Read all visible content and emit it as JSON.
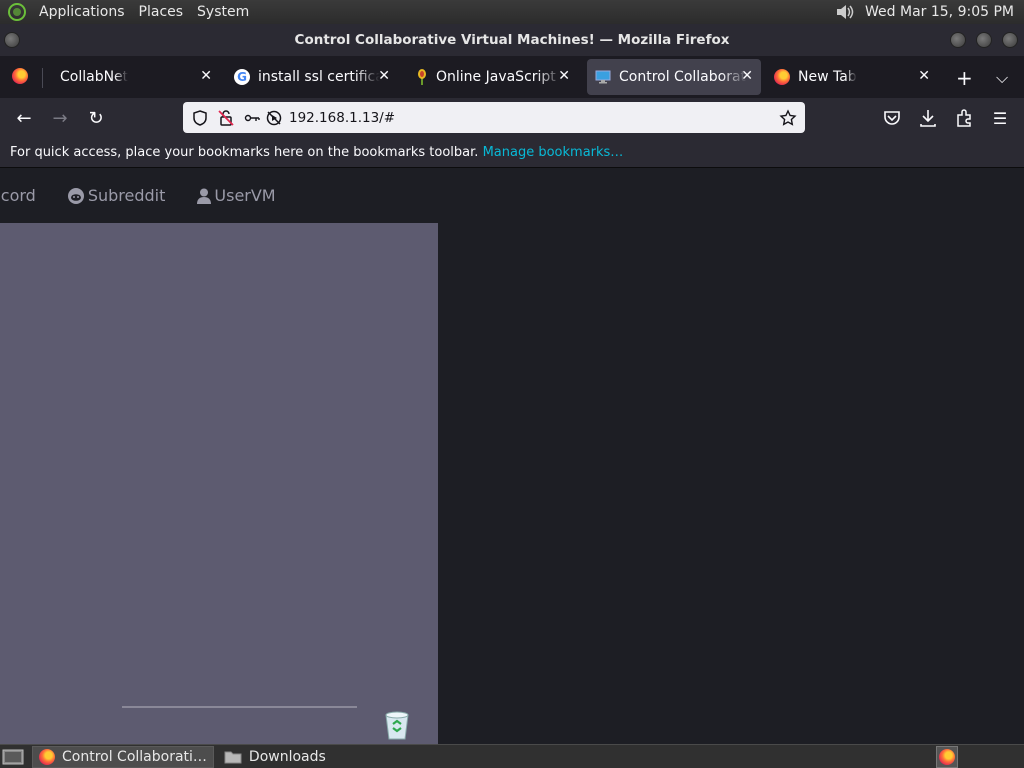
{
  "top_panel": {
    "menus": [
      "Applications",
      "Places",
      "System"
    ],
    "clock": "Wed Mar 15,  9:05 PM"
  },
  "window": {
    "title": "Control Collaborative Virtual Machines! — Mozilla Firefox"
  },
  "tabs": [
    {
      "label": "CollabNet",
      "icon": "firefox-icon"
    },
    {
      "label": "install ssl certificate",
      "icon": "google-icon"
    },
    {
      "label": "Online JavaScript be",
      "icon": "javascript-icon"
    },
    {
      "label": "Control Collaborative",
      "icon": "monitor-icon",
      "active": true
    },
    {
      "label": "New Tab",
      "icon": "firefox-icon"
    }
  ],
  "urlbar": {
    "url": "192.168.1.13/#"
  },
  "bookmarks_bar": {
    "text": "For quick access, place your bookmarks here on the bookmarks toolbar.",
    "link": "Manage bookmarks…"
  },
  "site_nav": [
    "iscord",
    "Subreddit",
    "UserVM"
  ],
  "taskbar": {
    "items": [
      {
        "label": "Control Collaborati…",
        "icon": "firefox-icon",
        "active": true
      },
      {
        "label": "Downloads",
        "icon": "folder-icon"
      }
    ]
  }
}
